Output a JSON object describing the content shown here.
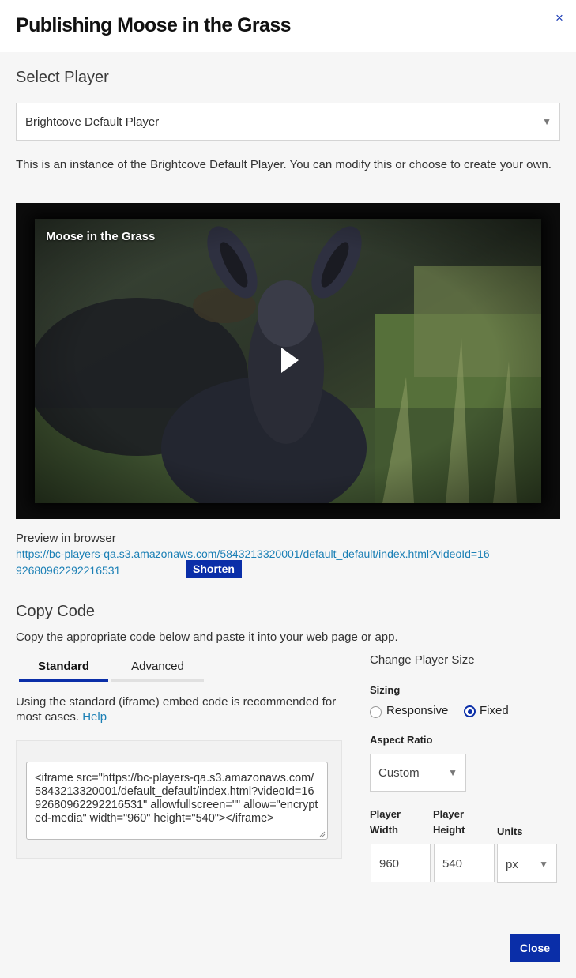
{
  "dialog": {
    "title": "Publishing Moose in the Grass",
    "close_icon": "×"
  },
  "select_player": {
    "heading": "Select Player",
    "selected": "Brightcove Default Player",
    "caret": "▼",
    "description": "This is an instance of the Brightcove Default Player. You can modify this or choose to create your own."
  },
  "video": {
    "title": "Moose in the Grass",
    "play_icon": "play-icon"
  },
  "preview": {
    "label": "Preview in browser",
    "url": "https://bc-players-qa.s3.amazonaws.com/5843213320001/default_default/index.html?videoId=1692680962292216531",
    "shorten_label": "Shorten"
  },
  "copy_code": {
    "heading": "Copy Code",
    "description": "Copy the appropriate code below and paste it into your web page or app.",
    "tabs": [
      {
        "label": "Standard",
        "active": true
      },
      {
        "label": "Advanced",
        "active": false
      }
    ],
    "note": "Using the standard (iframe) embed code is recommended for most cases.",
    "help_label": "Help",
    "code": "<iframe src=\"https://bc-players-qa.s3.amazonaws.com/5843213320001/default_default/index.html?videoId=1692680962292216531\" allowfullscreen=\"\" allow=\"encrypted-media\" width=\"960\" height=\"540\"></iframe>"
  },
  "player_size": {
    "heading": "Change Player Size",
    "sizing_label": "Sizing",
    "sizing_options": [
      {
        "label": "Responsive",
        "selected": false
      },
      {
        "label": "Fixed",
        "selected": true
      }
    ],
    "aspect_label": "Aspect Ratio",
    "aspect_value": "Custom",
    "width_label": "Player Width",
    "height_label": "Player Height",
    "units_label": "Units",
    "width_value": "960",
    "height_value": "540",
    "units_value": "px"
  },
  "footer": {
    "close_label": "Close"
  },
  "colors": {
    "accent": "#0a2ea8",
    "link": "#1a7fb5"
  }
}
